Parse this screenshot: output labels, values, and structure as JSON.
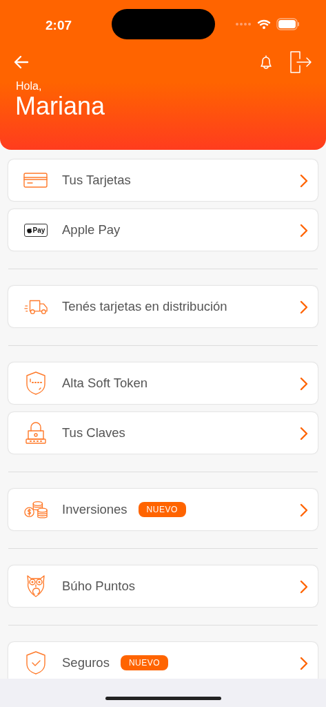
{
  "status_bar": {
    "time": "2:07"
  },
  "header": {
    "greeting": "Hola,",
    "name": "Mariana"
  },
  "groups": [
    {
      "items": [
        {
          "kind": "card",
          "label": "Tus Tarjetas"
        },
        {
          "kind": "applepay",
          "logo_text": "Pay",
          "label": "Apple Pay"
        }
      ]
    },
    {
      "items": [
        {
          "kind": "truck",
          "label": "Tenés tarjetas en distribución"
        }
      ]
    },
    {
      "items": [
        {
          "kind": "token",
          "label": "Alta Soft Token"
        },
        {
          "kind": "lock",
          "label": "Tus Claves"
        }
      ]
    },
    {
      "items": [
        {
          "kind": "coins",
          "label": "Inversiones",
          "badge": "NUEVO"
        }
      ]
    },
    {
      "items": [
        {
          "kind": "owl",
          "label": "Búho Puntos"
        }
      ]
    },
    {
      "items": [
        {
          "kind": "insurance",
          "label": "Seguros",
          "badge": "NUEVO"
        }
      ]
    }
  ]
}
